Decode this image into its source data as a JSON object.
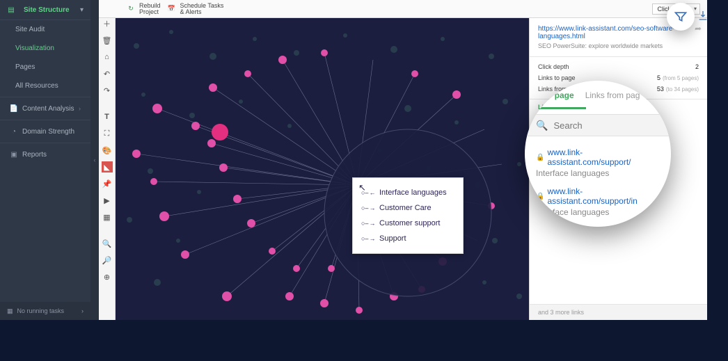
{
  "sidebar": {
    "title": "Site Structure",
    "items": [
      {
        "label": "Site Audit"
      },
      {
        "label": "Visualization"
      },
      {
        "label": "Pages"
      },
      {
        "label": "All Resources"
      }
    ],
    "sections": [
      {
        "label": "Content Analysis",
        "chev": "›"
      },
      {
        "label": "Domain Strength"
      },
      {
        "label": "Reports"
      }
    ],
    "footer": "No running tasks"
  },
  "topbar": {
    "rebuild": "Rebuild\nProject",
    "schedule": "Schedule Tasks\n& Alerts",
    "depth": "Click depth"
  },
  "tooltip": {
    "cursor": "↖",
    "rows": [
      {
        "dir": "←",
        "label": "Interface languages"
      },
      {
        "dir": "→",
        "label": "Customer Care"
      },
      {
        "dir": "→",
        "label": "Customer support"
      },
      {
        "dir": "→",
        "label": "Support"
      }
    ]
  },
  "rpanel": {
    "url": "https://www.link-assistant.com/seo-software-languages.html",
    "subtitle": "SEO PowerSuite: explore worldwide markets",
    "stats": [
      {
        "k": "Click depth",
        "v": "2",
        "sub": ""
      },
      {
        "k": "Links to page",
        "v": "5",
        "sub": "(from 5 pages)"
      },
      {
        "k": "Links from",
        "v": "53",
        "sub": "(to 34 pages)"
      }
    ],
    "tabs": [
      "Lin"
    ],
    "footer": "and 3 more links"
  },
  "lens": {
    "tabs": [
      "s to page",
      "Links from pag"
    ],
    "search_ph": "Search",
    "items": [
      {
        "url": "www.link-assistant.com/support/",
        "desc": "Interface languages"
      },
      {
        "url": "www.link-assistant.com/support/in",
        "desc": "Interface languages"
      }
    ]
  }
}
